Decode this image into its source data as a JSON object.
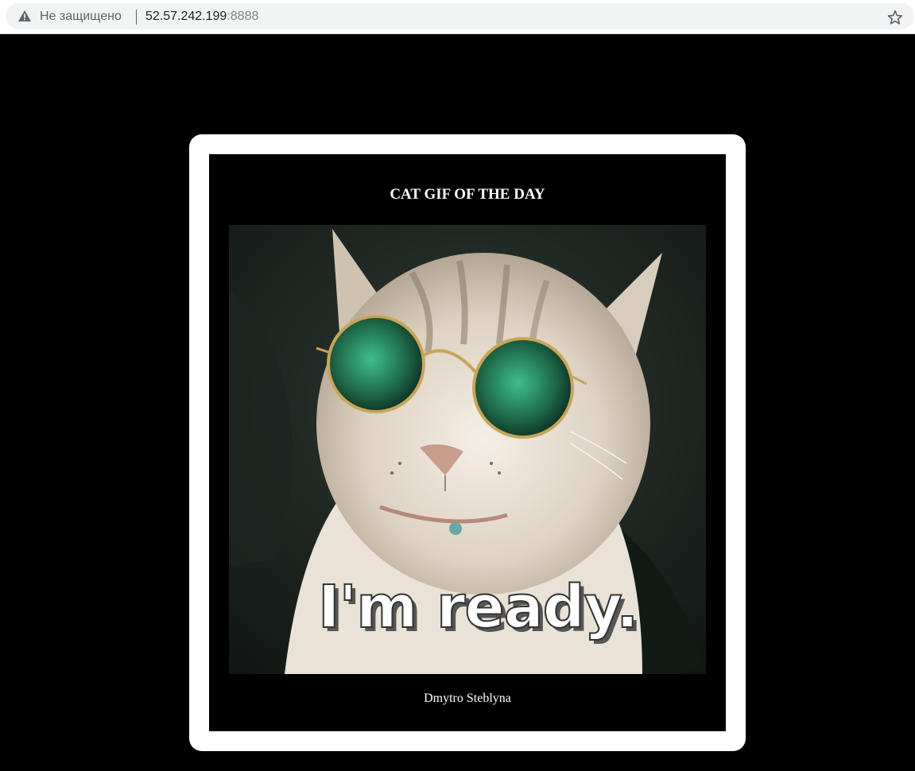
{
  "browser": {
    "security_label": "Не защищено",
    "url_host": "52.57.242.199",
    "url_port": ":8888",
    "icons": {
      "security": "warning-triangle-icon",
      "bookmark": "star-icon"
    }
  },
  "page": {
    "title": "CAT GIF OF THE DAY",
    "gif_caption": "I'm ready.",
    "author": "Dmytro Steblyna"
  }
}
